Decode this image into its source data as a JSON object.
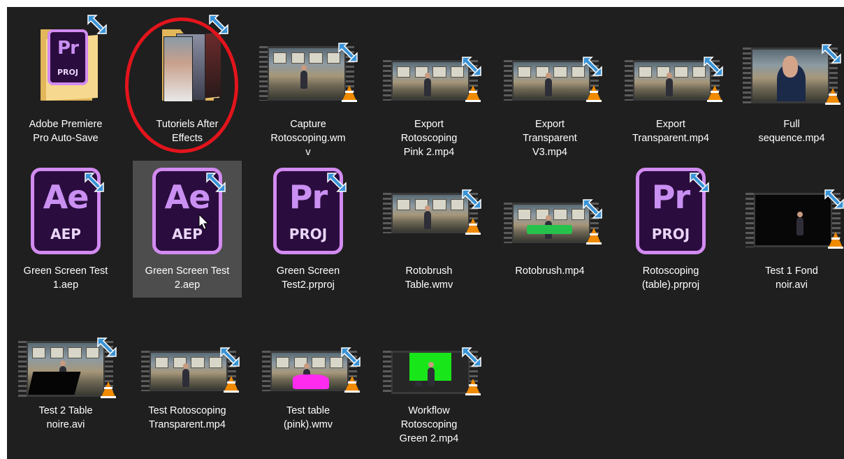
{
  "files": [
    {
      "label": "Adobe Premiere\nPro Auto-Save",
      "kind": "folder",
      "folder_badge": "Pr",
      "folder_badge_sub": "PROJ"
    },
    {
      "label": "Tutoriels After\nEffects",
      "kind": "folder-photos"
    },
    {
      "label": "Capture\nRotoscoping.wm\nv",
      "kind": "video"
    },
    {
      "label": "Export\nRotoscoping\nPink 2.mp4",
      "kind": "video",
      "bg": "#ff00ff"
    },
    {
      "label": "Export\nTransparent\nV3.mp4",
      "kind": "video"
    },
    {
      "label": "Export\nTransparent.mp4",
      "kind": "video"
    },
    {
      "label": "Full\nsequence.mp4",
      "kind": "video-news"
    },
    {
      "label": "Green Screen Test\n1.aep",
      "kind": "ae",
      "big": "Ae",
      "small": "AEP"
    },
    {
      "label": "Green Screen Test\n2.aep",
      "kind": "ae",
      "big": "Ae",
      "small": "AEP",
      "selected": true
    },
    {
      "label": "Green Screen\nTest2.prproj",
      "kind": "pr",
      "big": "Pr",
      "small": "PROJ"
    },
    {
      "label": "Rotobrush\nTable.wmv",
      "kind": "video"
    },
    {
      "label": "Rotobrush.mp4",
      "kind": "video-green"
    },
    {
      "label": "Rotoscoping\n(table).prproj",
      "kind": "pr",
      "big": "Pr",
      "small": "PROJ"
    },
    {
      "label": "Test 1 Fond\nnoir.avi",
      "kind": "video-black"
    },
    {
      "label": "Test 2 Table\nnoire.avi",
      "kind": "video-blacktable"
    },
    {
      "label": "Test Rotoscoping\nTransparent.mp4",
      "kind": "video"
    },
    {
      "label": "Test table\n(pink).wmv",
      "kind": "video-pinktable"
    },
    {
      "label": "Workflow\nRotoscoping\nGreen 2.mp4",
      "kind": "video-greenscreen",
      "bg": "#19e619"
    }
  ],
  "colors": {
    "panel": "#1f1f1f",
    "selection": "#4d4d4d",
    "annotation": "#e3141c",
    "shortcut_arrow": "#3a93d6",
    "vlc": "#f08a00",
    "doc_border": "#d28bf0"
  }
}
